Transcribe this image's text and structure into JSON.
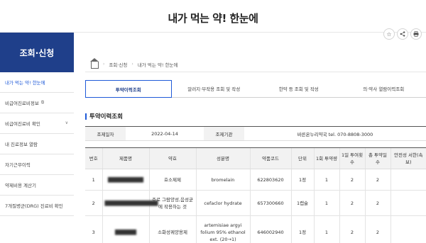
{
  "header": {
    "title": "내가 먹는 약! 한눈에"
  },
  "sidebar": {
    "title": "조회·신청",
    "items": [
      {
        "label": "내가 먹는 약! 한눈에",
        "active": true
      },
      {
        "label": "비급여진료비정보",
        "ext_icon": "external-link-icon"
      },
      {
        "label": "비급여진료비 확인",
        "has_children": true
      },
      {
        "label": "내 진료정보 열람"
      },
      {
        "label": "자기근무이력"
      },
      {
        "label": "약제비용 계산기"
      },
      {
        "label": "7개질병군(DRG) 진료비 확인"
      }
    ]
  },
  "toolbar": {
    "icons": [
      "star-icon",
      "share-icon",
      "print-icon"
    ]
  },
  "breadcrumb": {
    "items": [
      "조회·신청",
      "내가 먹는 약! 한눈에"
    ]
  },
  "tabs": [
    {
      "label": "투약이력조회",
      "active": true
    },
    {
      "label": "알러지·부작용 조회 및 작성"
    },
    {
      "label": "한약 등 조회 및 작성"
    },
    {
      "label": "의·약사 열람이력조회"
    }
  ],
  "section": {
    "title": "투약이력조회"
  },
  "info": {
    "date_label": "조제일자",
    "date_value": "2022-04-14",
    "org_label": "조제기관",
    "org_value": "바른온누리약국 tel. 070-8808-3000"
  },
  "table": {
    "headers": [
      "번호",
      "제품명",
      "약효",
      "성분명",
      "약품코드",
      "단위",
      "1회 투약량",
      "1일 투여횟수",
      "총 투약일수",
      "안전성 서한(속보)"
    ],
    "rows": [
      [
        "1",
        "██████████",
        "효소제제",
        "bromelain",
        "622803620",
        "1정",
        "1",
        "2",
        "2",
        ""
      ],
      [
        "2",
        "███████████████",
        "주로 그람양성,음성균에 작용하는 것",
        "cefaclor hydrate",
        "657300660",
        "1캡슐",
        "1",
        "2",
        "2",
        ""
      ],
      [
        "3",
        "██████",
        "소화성궤양용제",
        "artemisiae argyi folium 95% ethanol ext. (20→1)",
        "646002940",
        "1정",
        "1",
        "2",
        "2",
        ""
      ]
    ]
  },
  "colors": {
    "primary": "#1f3f8a",
    "accent": "#1f5ad8"
  }
}
